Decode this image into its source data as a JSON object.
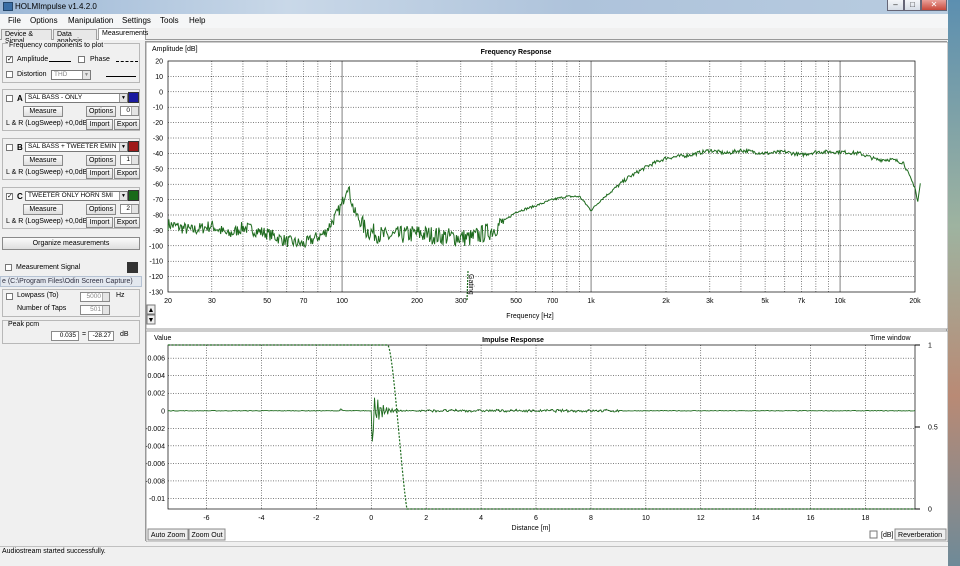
{
  "window": {
    "title": "HOLMImpulse  v1.4.2.0",
    "btn_min": "–",
    "btn_max": "□",
    "btn_close": "✕"
  },
  "menu": [
    "File",
    "Options",
    "Manipulation",
    "Settings",
    "Tools",
    "Help"
  ],
  "tabs": [
    "Device & Signal",
    "Data analysis",
    "Measurements"
  ],
  "left": {
    "freq_group_title": "Frequency components to plot",
    "amplitude_label": "Amplitude",
    "phase_label": "Phase",
    "distortion_label": "Distortion",
    "distortion_value": "THD",
    "channels": [
      {
        "letter": "A",
        "checked": false,
        "name": "SAL BASS - ONLY",
        "color": "#1a1aa0",
        "measure": "Measure",
        "options": "Options",
        "spin": "0",
        "info": "L & R (LogSweep) +0,0dB",
        "import": "Import",
        "export": "Export"
      },
      {
        "letter": "B",
        "checked": false,
        "name": "SAL BASS + TWEETER EMIN",
        "color": "#a01a1a",
        "measure": "Measure",
        "options": "Options",
        "spin": "1",
        "info": "L & R (LogSweep) +0,0dB",
        "import": "Import",
        "export": "Export"
      },
      {
        "letter": "C",
        "checked": true,
        "name": "TWEETER ONLY HORN SMI",
        "color": "#1a6a1a",
        "measure": "Measure",
        "options": "Options",
        "spin": "2",
        "info": "L & R (LogSweep) +0,0dB",
        "import": "Import",
        "export": "Export"
      }
    ],
    "organize": "Organize measurements",
    "meas_signal": "Measurement Signal",
    "meas_signal_color": "#333333",
    "path": "e (C:\\Program Files\\Odin Screen Capture)",
    "lowpass_label": "Lowpass (To)",
    "lowpass_value": "5000",
    "lowpass_unit": "Hz",
    "taps_label": "Number of Taps",
    "taps_value": "501",
    "peak_label": "Peak pcm",
    "peak_value": "0.035",
    "peak_db": "-28.27",
    "db_unit": "dB"
  },
  "freq_chart": {
    "title": "Frequency Response",
    "ylabel": "Amplitude [dB]",
    "xlabel": "Frequency [Hz]",
    "marker_label": "Gating",
    "trace_color": "#1e6b1e",
    "xticks": [
      "20",
      "30",
      "50",
      "70",
      "100",
      "200",
      "300",
      "500",
      "700",
      "1k",
      "2k",
      "3k",
      "5k",
      "7k",
      "10k",
      "20k"
    ],
    "yticks": [
      "20",
      "10",
      "0",
      "-10",
      "-20",
      "-30",
      "-40",
      "-50",
      "-60",
      "-70",
      "-80",
      "-90",
      "-100",
      "-110",
      "-120",
      "-130"
    ]
  },
  "impulse_chart": {
    "title": "Impulse Response",
    "ylabel": "Value",
    "xlabel": "Distance [m]",
    "right_label": "Time window",
    "yticks": [
      "0.006",
      "0.004",
      "0.002",
      "0",
      "-0.002",
      "-0.004",
      "-0.006",
      "-0.008",
      "-0.01"
    ],
    "xticks": [
      "-6",
      "-4",
      "-2",
      "0",
      "2",
      "4",
      "6",
      "8",
      "10",
      "12",
      "14",
      "16",
      "18"
    ],
    "right_ticks": [
      "1",
      "0.5",
      "0"
    ],
    "auto_zoom": "Auto Zoom",
    "zoom_out": "Zoom Out",
    "db_check": "[dB]",
    "reverberation": "Reverberation"
  },
  "status": "Audiostream started successfully."
}
